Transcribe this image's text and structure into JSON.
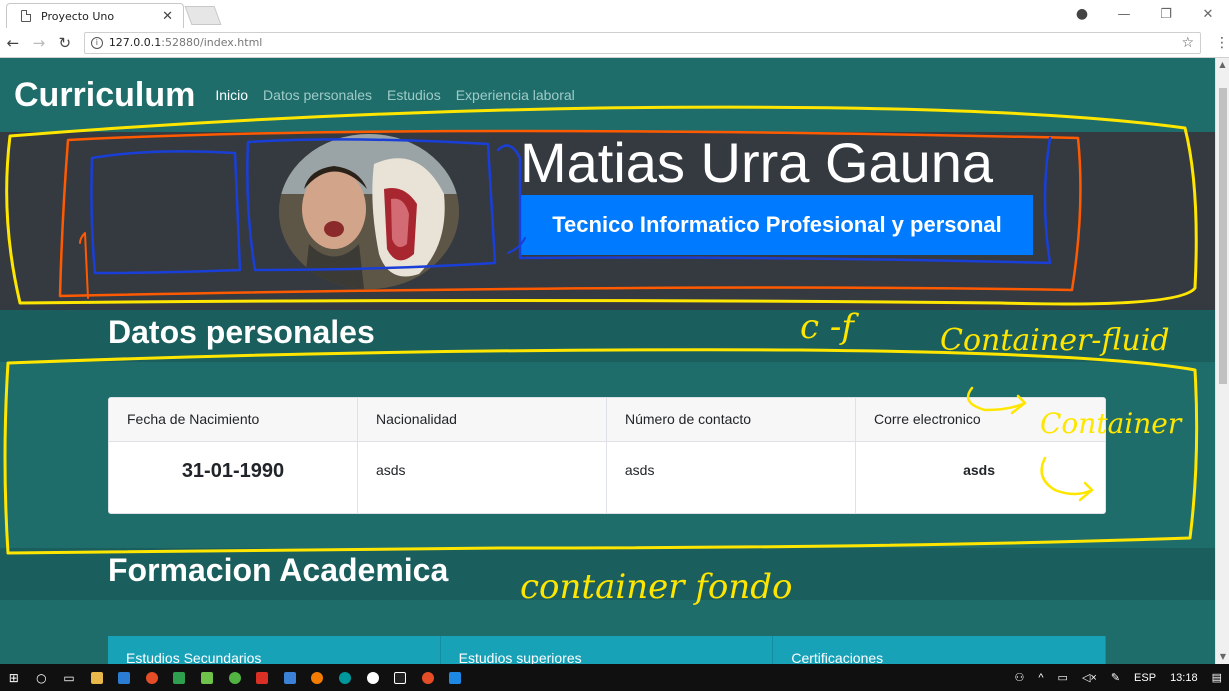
{
  "browser": {
    "tab_title": "Proyecto Uno",
    "tab_close": "✕",
    "url_host": "127.0.0.1",
    "url_rest": ":52880/index.html"
  },
  "navbar": {
    "brand": "Curriculum",
    "links": [
      "Inicio",
      "Datos personales",
      "Estudios",
      "Experiencia laboral"
    ]
  },
  "hero": {
    "name": "Matias Urra Gauna",
    "subtitle": "Tecnico Informatico Profesional y personal"
  },
  "datos": {
    "title": "Datos personales",
    "headers": [
      "Fecha de Nacimiento",
      "Nacionalidad",
      "Número de contacto",
      "Corre electronico"
    ],
    "values": [
      "31-01-1990",
      "asds",
      "asds",
      "asds"
    ]
  },
  "formacion": {
    "title": "Formacion Academica",
    "headers": [
      "Estudios Secundarios",
      "Estudios superiores",
      "Certificaciones"
    ]
  },
  "annotations": {
    "c_f": "c -f",
    "container_fluid": "Container-fluid",
    "container": "Container",
    "container_fondo": "container fondo"
  },
  "taskbar": {
    "lang": "ESP",
    "time": "13:18"
  },
  "colors": {
    "page_bg": "#1f6d6b",
    "hero_bg": "#343a40",
    "primary": "#007bff",
    "info": "#17a2b8",
    "annotation_yellow": "#ffff00",
    "annotation_blue": "#1a3fd8",
    "annotation_orange": "#ff5a00"
  }
}
